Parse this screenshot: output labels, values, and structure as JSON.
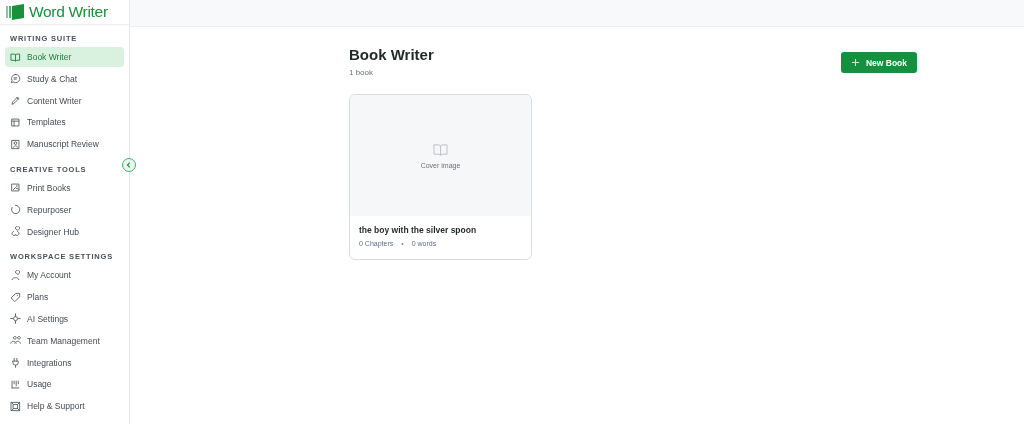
{
  "brand": {
    "name": "Word Writer"
  },
  "sidebar": {
    "sections": [
      {
        "heading": "WRITING SUITE",
        "items": [
          {
            "label": "Book Writer",
            "selected": true
          },
          {
            "label": "Study & Chat",
            "selected": false
          },
          {
            "label": "Content Writer",
            "selected": false
          },
          {
            "label": "Templates",
            "selected": false
          },
          {
            "label": "Manuscript Review",
            "selected": false
          }
        ]
      },
      {
        "heading": "CREATIVE TOOLS",
        "items": [
          {
            "label": "Print Books",
            "selected": false
          },
          {
            "label": "Repurposer",
            "selected": false
          },
          {
            "label": "Designer Hub",
            "selected": false
          }
        ]
      },
      {
        "heading": "WORKSPACE SETTINGS",
        "items": [
          {
            "label": "My Account",
            "selected": false
          },
          {
            "label": "Plans",
            "selected": false
          },
          {
            "label": "AI Settings",
            "selected": false
          },
          {
            "label": "Team Management",
            "selected": false
          },
          {
            "label": "Integrations",
            "selected": false
          },
          {
            "label": "Usage",
            "selected": false
          },
          {
            "label": "Help & Support",
            "selected": false
          }
        ]
      }
    ]
  },
  "page": {
    "title": "Book Writer",
    "subtitle": "1 book",
    "new_button": "New Book"
  },
  "books": [
    {
      "cover_label": "Cover image",
      "title": "the boy with the silver spoon",
      "chapters": "0 Chapters",
      "separator": "•",
      "words": "0 words"
    }
  ]
}
